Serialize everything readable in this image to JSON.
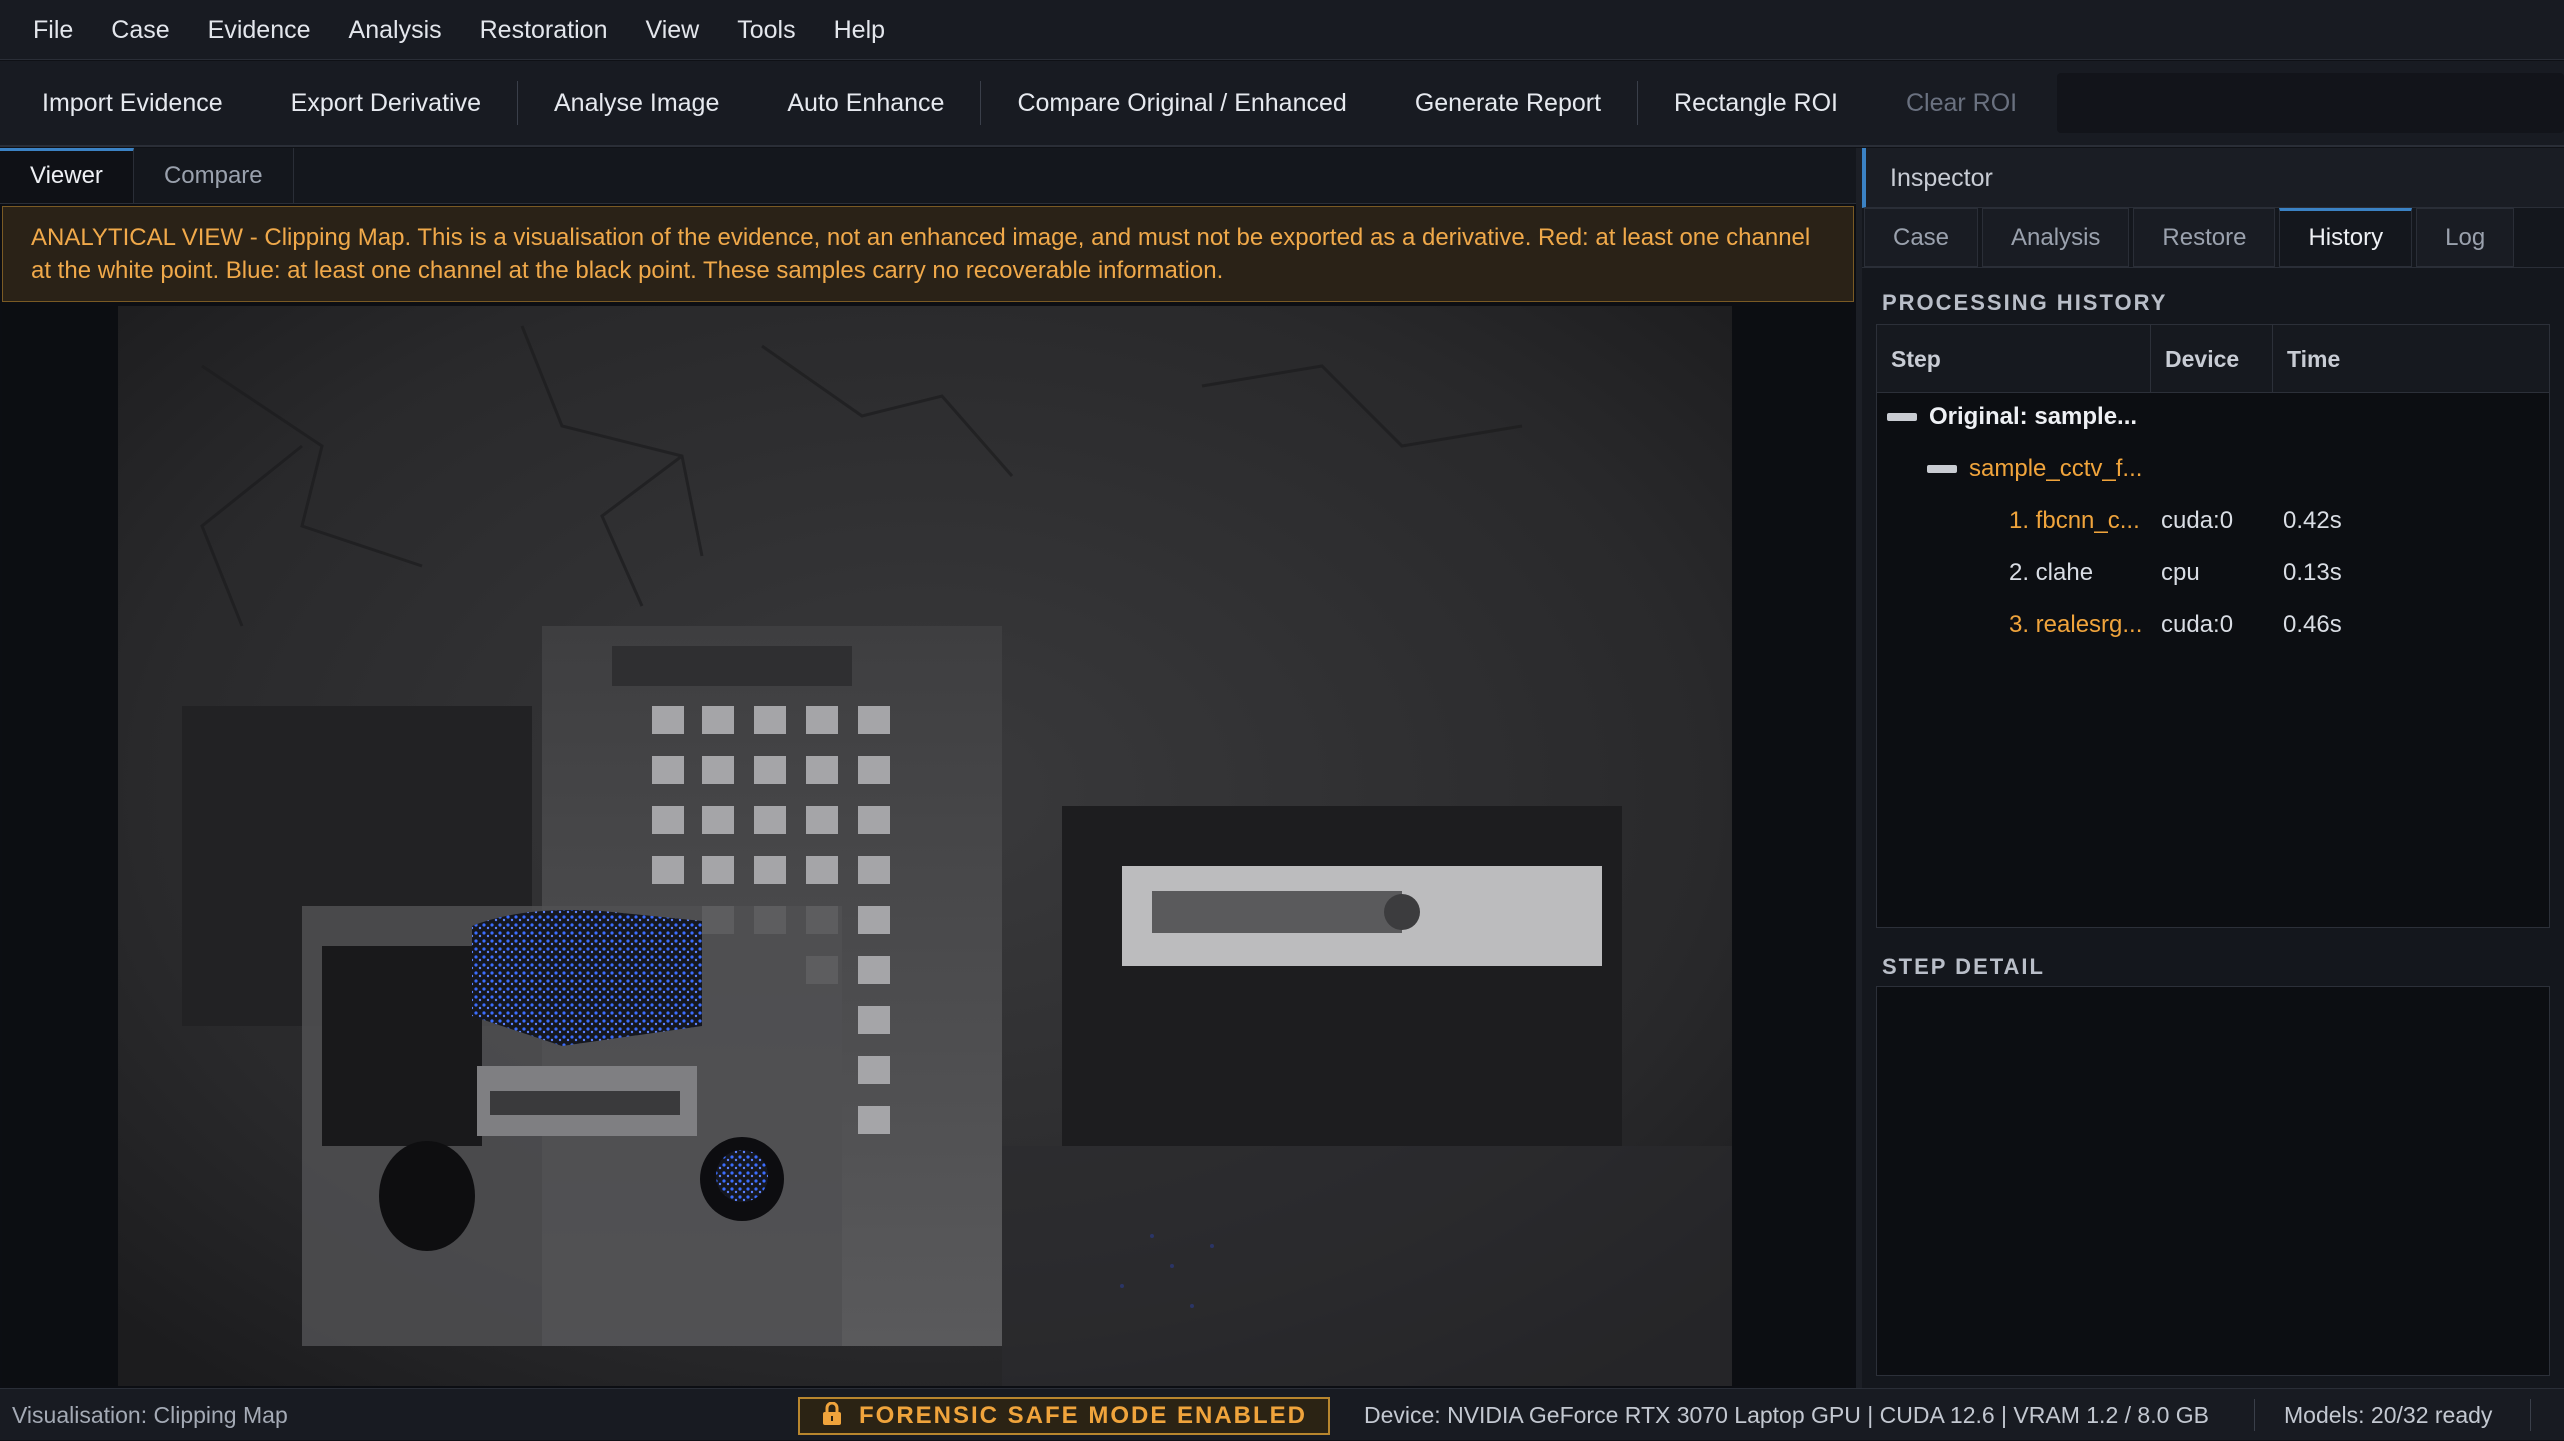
{
  "menu": [
    "File",
    "Case",
    "Evidence",
    "Analysis",
    "Restoration",
    "View",
    "Tools",
    "Help"
  ],
  "toolbar": {
    "import_evidence": "Import Evidence",
    "export_derivative": "Export Derivative",
    "analyse_image": "Analyse Image",
    "auto_enhance": "Auto Enhance",
    "compare": "Compare Original / Enhanced",
    "generate_report": "Generate Report",
    "rectangle_roi": "Rectangle ROI",
    "clear_roi": "Clear ROI"
  },
  "viewer": {
    "tabs": [
      "Viewer",
      "Compare"
    ],
    "active_tab": "Viewer",
    "warning": "ANALYTICAL VIEW - Clipping Map. This is a visualisation of the evidence, not an enhanced image, and must not be exported as a derivative. Red: at least one channel at the white point. Blue: at least one channel at the black point. These samples carry no recoverable information."
  },
  "inspector": {
    "title": "Inspector",
    "tabs": [
      "Case",
      "Analysis",
      "Restore",
      "History",
      "Log"
    ],
    "active_tab": "History",
    "history": {
      "title": "PROCESSING HISTORY",
      "columns": [
        "Step",
        "Device",
        "Time"
      ],
      "root": "Original: sample...",
      "source": "sample_cctv_f...",
      "steps": [
        {
          "step": "1. fbcnn_c...",
          "device": "cuda:0",
          "time": "0.42s",
          "highlight": true
        },
        {
          "step": "2. clahe",
          "device": "cpu",
          "time": "0.13s",
          "highlight": false
        },
        {
          "step": "3. realesrg...",
          "device": "cuda:0",
          "time": "0.46s",
          "highlight": true
        }
      ]
    },
    "step_detail_title": "STEP DETAIL"
  },
  "status": {
    "visualisation": "Visualisation: Clipping Map",
    "safe_mode": "FORENSIC SAFE MODE ENABLED",
    "device": "Device: NVIDIA GeForce RTX 3070 Laptop GPU  |  CUDA 12.6  |  VRAM 1.2 / 8.0 GB",
    "models": "Models: 20/32 ready"
  },
  "colors": {
    "accent": "#3b82c4",
    "warning": "#f0a94a",
    "clip_blue": "#3a6cff",
    "highlight": "#f0a43c"
  },
  "icons": {
    "safe_mode": "lock-icon",
    "tree_collapse": "collapse-icon"
  }
}
